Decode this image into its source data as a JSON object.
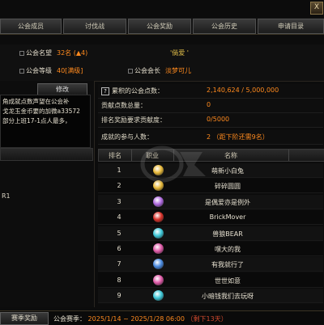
{
  "window": {
    "close_glyph": "X"
  },
  "tabs": [
    "公会成员",
    "讨伐战",
    "公会奖励",
    "公会历史",
    "申请目录"
  ],
  "guild": {
    "name_label": "公会名望",
    "name_value": "32名 (▲4)",
    "motto": "'倘爱 '",
    "level_label": "公会等级",
    "level_value": "40[满级]",
    "leader_label": "公会会长",
    "leader_value": "淡梦可儿"
  },
  "left_panel": {
    "edit_button": "修改",
    "notice_lines": [
      "角成就点数声望在公会补",
      "戈龙玉金币要的加微a33572",
      "部分上班17-1点人最多，"
    ],
    "trailing_text": "R1"
  },
  "stats": [
    {
      "label": "累积的公会点数：",
      "value": "2,140,624 / 5,000,000",
      "has_q_icon": true
    },
    {
      "label": "贡献点数总量：",
      "value": "0"
    },
    {
      "label": "排名奖励要求贡献度：",
      "value": "0/5000"
    },
    {
      "label": "成就的参与人数：",
      "value": "2 （距下阶还需9名）"
    }
  ],
  "table": {
    "headers": [
      "排名",
      "职业",
      "名称"
    ],
    "rows": [
      {
        "rank": "1",
        "job_icon": "class-icon-yellow",
        "name": "萌新小白兔"
      },
      {
        "rank": "2",
        "job_icon": "class-icon-yellow",
        "name": "碎碎圆圆"
      },
      {
        "rank": "3",
        "job_icon": "class-icon-purple",
        "name": "是偶爱亦是例外"
      },
      {
        "rank": "4",
        "job_icon": "class-icon-red",
        "name": "BrickMover"
      },
      {
        "rank": "5",
        "job_icon": "class-icon-cyan",
        "name": "兽狼BEAR"
      },
      {
        "rank": "6",
        "job_icon": "class-icon-pink",
        "name": "嘿大的我"
      },
      {
        "rank": "7",
        "job_icon": "class-icon-blue",
        "name": "有我就行了"
      },
      {
        "rank": "8",
        "job_icon": "class-icon-pink",
        "name": "世世如意"
      },
      {
        "rank": "9",
        "job_icon": "class-icon-cyan",
        "name": "小暗钱我们去玩呀"
      }
    ]
  },
  "colors": {
    "accent_orange": "#ff8a1e",
    "remain_red": "#d04a2e",
    "class-icon-yellow": "#e8b93a",
    "class-icon-purple": "#b06ae0",
    "class-icon-red": "#d8322a",
    "class-icon-cyan": "#3ec8d8",
    "class-icon-pink": "#e05aa8",
    "class-icon-blue": "#4a8ae0"
  },
  "bottom": {
    "season_button": "赛季奖励",
    "season_label": "公会赛季：",
    "season_range": "2025/1/14 ~ 2025/1/28 06:00",
    "season_remaining": "（剩下13天）"
  }
}
